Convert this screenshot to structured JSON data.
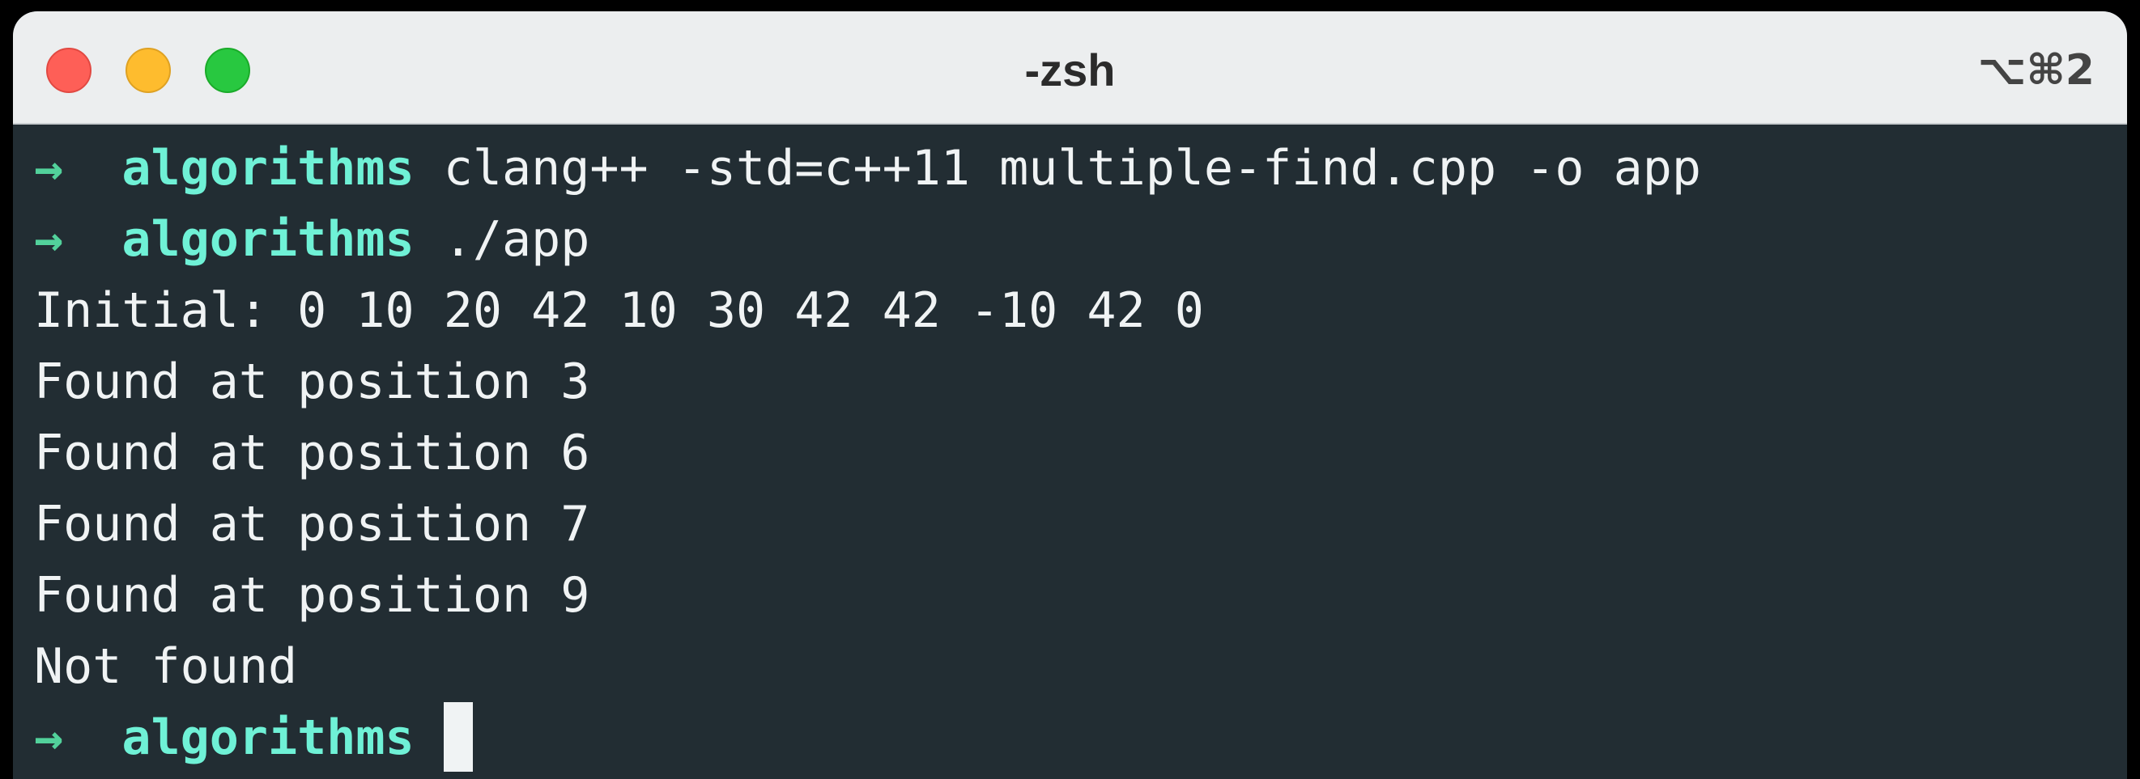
{
  "window": {
    "title": "-zsh",
    "shortcut": "⌥⌘2"
  },
  "colors": {
    "background": "#222d33",
    "titlebar": "#eceeef",
    "prompt_arrow": "#52d19b",
    "prompt_dir": "#6ff1d6",
    "text": "#f0f3f4",
    "close": "#fe5f57",
    "minimize": "#febc2e",
    "zoom": "#28c840"
  },
  "terminal": {
    "prompt_arrow": "→",
    "prompt_dir": "algorithms",
    "commands": [
      "clang++ -std=c++11 multiple-find.cpp -o app",
      "./app"
    ],
    "output": [
      "Initial: 0 10 20 42 10 30 42 42 -10 42 0",
      "Found at position 3",
      "Found at position 6",
      "Found at position 7",
      "Found at position 9",
      "Not found"
    ]
  }
}
